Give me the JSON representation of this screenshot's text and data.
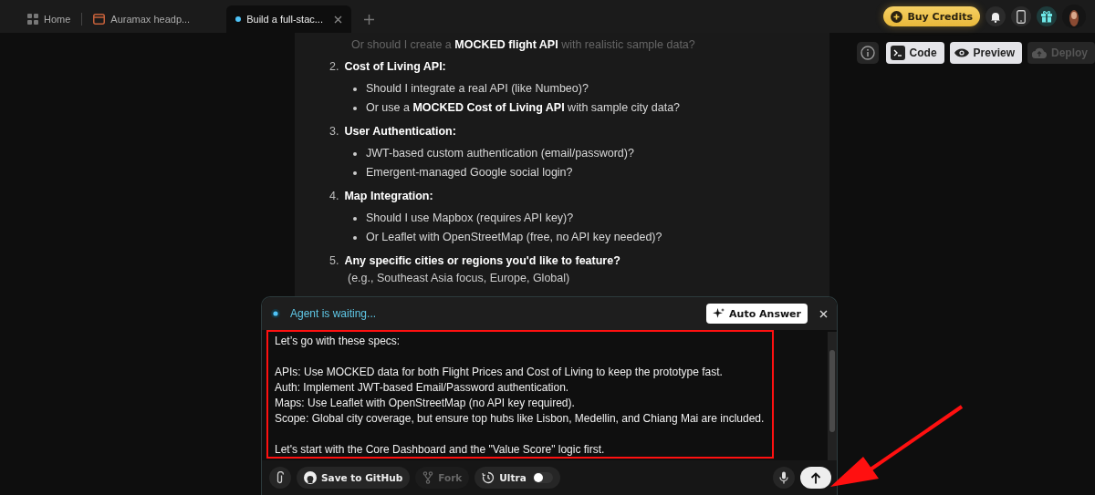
{
  "tabs": [
    {
      "label": "Home",
      "kind": "home",
      "selected": false
    },
    {
      "label": "Auramax headp...",
      "kind": "page",
      "selected": false
    },
    {
      "label": "Build a full-stac...",
      "kind": "chat",
      "selected": true
    }
  ],
  "header": {
    "buy_credits": "Buy Credits"
  },
  "toolbar": {
    "buttons": [
      {
        "label": "Code",
        "kind": "code",
        "disabled": false
      },
      {
        "label": "Preview",
        "kind": "preview",
        "disabled": false
      },
      {
        "label": "Deploy",
        "kind": "deploy",
        "disabled": true
      }
    ]
  },
  "chat": {
    "lead_line": "Or should I create a **MOCKED flight API** with realistic sample data?",
    "sections": [
      {
        "number": "2.",
        "title": "Cost of Living API:",
        "bullets": [
          "Should I integrate a real API (like Numbeo)?",
          "Or use a **MOCKED Cost of Living API** with sample city data?"
        ]
      },
      {
        "number": "3.",
        "title": "User Authentication:",
        "bullets": [
          "JWT-based custom authentication (email/password)?",
          "Emergent-managed Google social login?"
        ]
      },
      {
        "number": "4.",
        "title": "Map Integration:",
        "bullets": [
          "Should I use Mapbox (requires API key)?",
          "Or Leaflet with OpenStreetMap (free, no API key needed)?"
        ]
      },
      {
        "number": "5.",
        "title": "Any specific cities or regions you'd like to feature?",
        "note": "(e.g., Southeast Asia focus, Europe, Global)"
      }
    ]
  },
  "composer": {
    "status": "Agent is waiting...",
    "auto_answer": "Auto Answer",
    "message": [
      [
        "Let’s go with these specs:"
      ],
      [
        "APIs: Use MOCKED data for both Flight Prices and Cost of Living to keep the prototype fast.",
        "Auth: Implement JWT-based Email/Password authentication.",
        "Maps: Use Leaflet with OpenStreetMap (no API key required).",
        "Scope: Global city coverage, but ensure top hubs like Lisbon, Medellin, and Chiang Mai are included."
      ],
      [
        "Let's start with the Core Dashboard and the \"Value Score\" logic first."
      ]
    ],
    "actions": [
      {
        "label": "Save to GitHub",
        "kind": "github",
        "disabled": false
      },
      {
        "label": "Fork",
        "kind": "fork",
        "disabled": true
      },
      {
        "label": "Ultra",
        "kind": "ultra",
        "disabled": false,
        "on": false
      }
    ]
  }
}
